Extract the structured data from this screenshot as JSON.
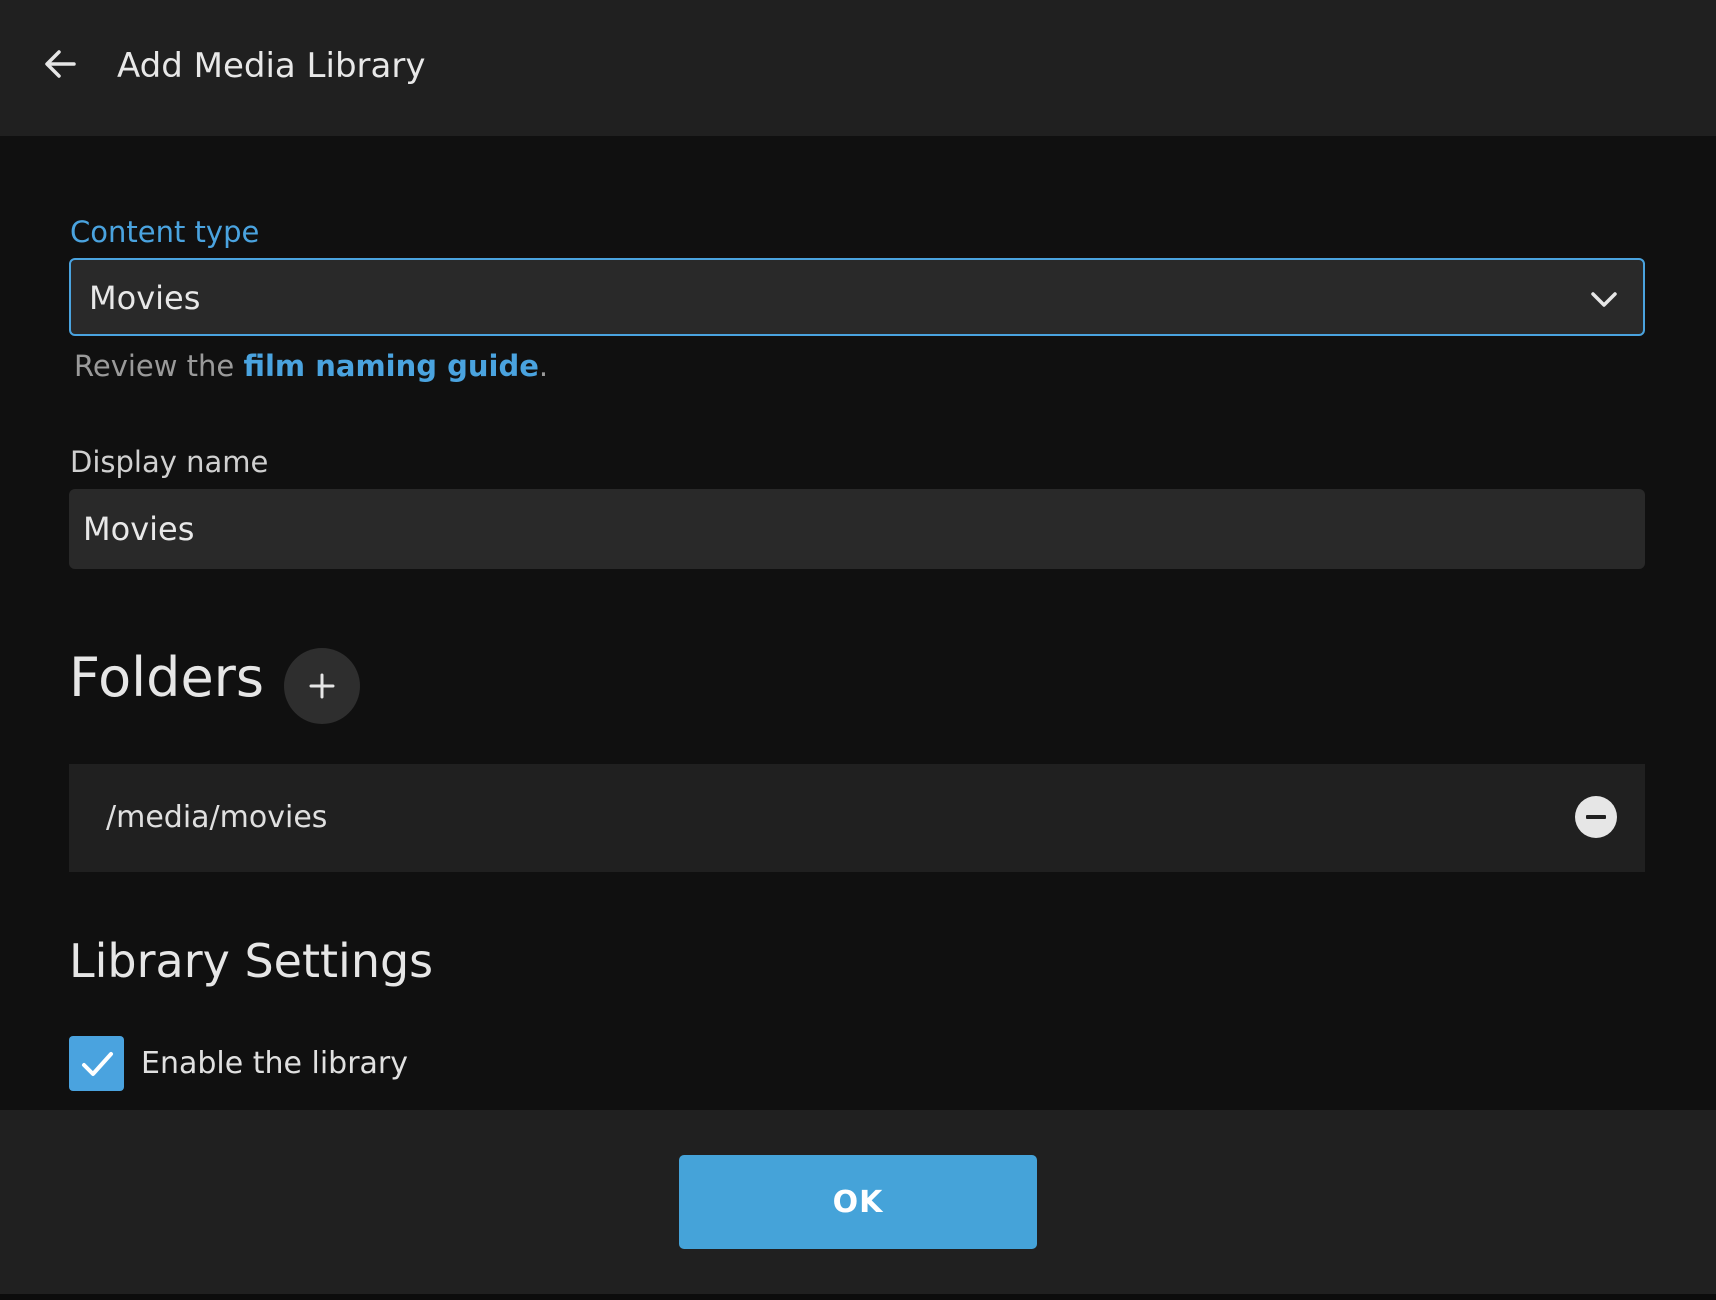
{
  "header": {
    "title": "Add Media Library",
    "back_icon": "arrow-left-icon"
  },
  "content_type": {
    "label": "Content type",
    "selected": "Movies",
    "chevron_icon": "chevron-down-icon"
  },
  "help": {
    "prefix": "Review the ",
    "link_text": "film naming guide",
    "suffix": "."
  },
  "display_name": {
    "label": "Display name",
    "value": "Movies"
  },
  "folders": {
    "title": "Folders",
    "add_icon": "plus-icon",
    "items": [
      {
        "path": "/media/movies",
        "remove_icon": "minus-circle-icon"
      }
    ]
  },
  "library_settings": {
    "title": "Library Settings",
    "enable_label": "Enable the library",
    "enable_checked": true
  },
  "footer": {
    "ok_label": "OK"
  },
  "colors": {
    "accent": "#4aa3df",
    "header_bg": "#202020",
    "page_bg": "#101010",
    "input_bg": "#292929"
  }
}
